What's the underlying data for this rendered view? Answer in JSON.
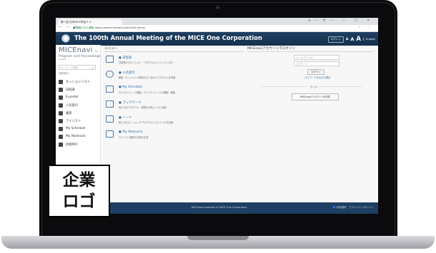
{
  "browser": {
    "tab_title": "第一回 日本MICE学会テ ×",
    "url_secure": "● 保護された通信",
    "url": "https://www.micenavi.jp/mice/ja_demo/",
    "window_controls": "ユーザー ─ ☐ ✕"
  },
  "site": {
    "title": "The 100th Annual Meeting of the MICE One Corporation",
    "login_button": "ログイン",
    "font_sizes": [
      "A",
      "A",
      "A"
    ],
    "language": "English"
  },
  "sidebar": {
    "brand": "MICEnavi",
    "brand_tag": "for events",
    "subtitle": "Program and Proceedings",
    "search_placeholder": "キーワード検索",
    "search_note": "詳細検索 ▽",
    "items": [
      {
        "label": "セッションリスト",
        "icon": "list-icon"
      },
      {
        "label": "日程表",
        "icon": "calendar-icon"
      },
      {
        "label": "E-poster",
        "icon": "monitor-icon"
      },
      {
        "label": "人名索引",
        "icon": "person-icon"
      },
      {
        "label": "検索",
        "icon": "search-icon"
      },
      {
        "label": "アイリスト",
        "icon": "clipboard-icon"
      },
      {
        "label": "My Schedule",
        "icon": "calendar-check-icon"
      },
      {
        "label": "My Abstracts",
        "icon": "abstract-icon"
      },
      {
        "label": "抄録PDF",
        "icon": "pdf-icon"
      }
    ]
  },
  "main": {
    "heading": "メニュー",
    "items": [
      {
        "title": "● 日程表",
        "desc": "日程表からセッション・プログラムにジャンプします",
        "icon": "calendar-grid-icon"
      },
      {
        "title": "● 人名索引",
        "desc": "著者・セッションの座長など人名からプログラムを検索",
        "icon": "people-icon"
      },
      {
        "title": "● My Schedule",
        "desc": "マイスケジュール機能・マイスケジュールの確認・編集",
        "icon": "schedule-icon"
      },
      {
        "title": "● ブックマーク",
        "desc": "気になるプログラム・発表をお気に入りに追加",
        "icon": "book-icon"
      },
      {
        "title": "● ノート",
        "desc": "気になるセッションやプログラムについてメモを記録",
        "icon": "note-icon"
      },
      {
        "title": "● My Abstracts",
        "desc": "マイリスト要約の抄録の生成",
        "icon": "abstracts-icon"
      }
    ]
  },
  "login": {
    "heading": "MICEnaviアカウントでログイン",
    "email_placeholder": "メールアドレス",
    "password_placeholder": "パスワード",
    "submit": "ログイン",
    "forgot": "パスワードを忘れた場合",
    "or": "または",
    "create": "MICEnaviアカウントを作成"
  },
  "footer": {
    "powered": "MICEnavi powered by MICE One Corporation",
    "links": "利用規約　プライバシーポリシー"
  },
  "overlay": {
    "line1": "企業",
    "line2": "ロゴ"
  },
  "colors": {
    "header": "#1e3f62",
    "link": "#2e6da4",
    "laptop": "#0b0b0d"
  }
}
